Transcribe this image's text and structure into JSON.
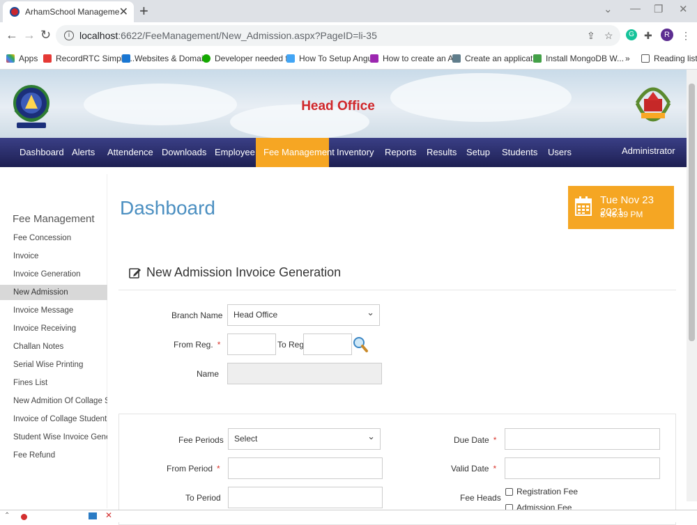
{
  "browser": {
    "tab_title": "ArhamSchool Management",
    "url_host": "localhost",
    "url_path": ":6622/FeeManagement/New_Admission.aspx?PageID=li-35",
    "profile_initial": "R",
    "bookmarks": [
      {
        "label": "Apps"
      },
      {
        "label": "RecordRTC Simple..."
      },
      {
        "label": "Websites & Domai..."
      },
      {
        "label": "Developer needed f..."
      },
      {
        "label": "How To Setup Angu..."
      },
      {
        "label": "How to create an A..."
      },
      {
        "label": "Create an applicati..."
      },
      {
        "label": "Install MongoDB W..."
      }
    ],
    "reading_list": "Reading list",
    "more": "»"
  },
  "header": {
    "title": "Head Office"
  },
  "nav": {
    "items": [
      {
        "label": "Dashboard"
      },
      {
        "label": "Alerts"
      },
      {
        "label": "Attendence"
      },
      {
        "label": "Downloads"
      },
      {
        "label": "Employee"
      },
      {
        "label": "Fee Management"
      },
      {
        "label": "Inventory"
      },
      {
        "label": "Reports"
      },
      {
        "label": "Results"
      },
      {
        "label": "Setup"
      },
      {
        "label": "Students"
      },
      {
        "label": "Users"
      }
    ],
    "active": "Fee Management",
    "user": "Administrator"
  },
  "sidebar": {
    "title": "Fee Management",
    "items": [
      {
        "label": "Fee Concession"
      },
      {
        "label": "Invoice"
      },
      {
        "label": "Invoice Generation"
      },
      {
        "label": "New Admission"
      },
      {
        "label": "Invoice Message"
      },
      {
        "label": "Invoice Receiving"
      },
      {
        "label": "Challan Notes"
      },
      {
        "label": "Serial Wise Printing"
      },
      {
        "label": "Fines List"
      },
      {
        "label": "New Admition Of Collage Stu..."
      },
      {
        "label": "Invoice of Collage Student"
      },
      {
        "label": "Student Wise Invoice Genera..."
      },
      {
        "label": "Fee Refund"
      }
    ],
    "active": "New Admission"
  },
  "main": {
    "page_title": "Dashboard",
    "date": "Tue Nov 23 2021",
    "time": "8:46:39 PM",
    "section_title": "New Admission Invoice Generation",
    "form": {
      "branch_label": "Branch Name",
      "branch_value": "Head Office",
      "from_reg_label": "From Reg.",
      "to_reg_label": "To Reg.",
      "name_label": "Name",
      "required_mark": "*"
    },
    "panel": {
      "fee_periods_label": "Fee Periods",
      "fee_periods_value": "Select",
      "from_period_label": "From Period",
      "to_period_label": "To Period",
      "due_date_label": "Due Date",
      "valid_date_label": "Valid Date",
      "fee_heads_label": "Fee Heads",
      "fee_heads": [
        {
          "label": "Registration Fee",
          "checked": false
        },
        {
          "label": "Admission Fee",
          "checked": false
        }
      ]
    }
  },
  "colors": {
    "nav_bg": "#23275e",
    "nav_active": "#f6a623",
    "header_title": "#d0262a",
    "page_title": "#4b8fc1",
    "date_box": "#f5a623",
    "required": "#d9342b"
  }
}
